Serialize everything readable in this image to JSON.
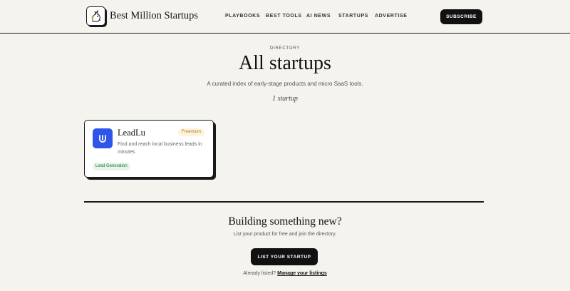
{
  "header": {
    "brand": "Best Million Startups",
    "nav": [
      {
        "label": "PLAYBOOKS"
      },
      {
        "label": "BEST TOOLS"
      },
      {
        "label": "AI NEWS"
      },
      {
        "label": "STARTUPS"
      },
      {
        "label": "ADVERTISE"
      }
    ],
    "subscribe_label": "SUBSCRIBE"
  },
  "hero": {
    "eyebrow": "DIRECTORY",
    "title": "All startups",
    "subtitle": "A curated index of early-stage products and micro SaaS tools.",
    "count": "1 startup"
  },
  "startups": [
    {
      "name": "LeadLu",
      "pricing": "Freemium",
      "description": "Find and reach local business leads in minutes",
      "tag": "Lead Generation",
      "logo_icon": "leadlu-logo-icon",
      "logo_color": "#2f55e8"
    }
  ],
  "cta": {
    "title": "Building something new?",
    "subtitle": "List your product for free and join the directory.",
    "button_label": "LIST YOUR STARTUP",
    "already_text": "Already listed?",
    "manage_link": "Manage your listings"
  },
  "colors": {
    "background": "#f4f3ee",
    "ink": "#111111",
    "accent_blue": "#2f55e8",
    "badge_amber": "#fdf2dc",
    "tag_green": "#e4f6ea"
  }
}
